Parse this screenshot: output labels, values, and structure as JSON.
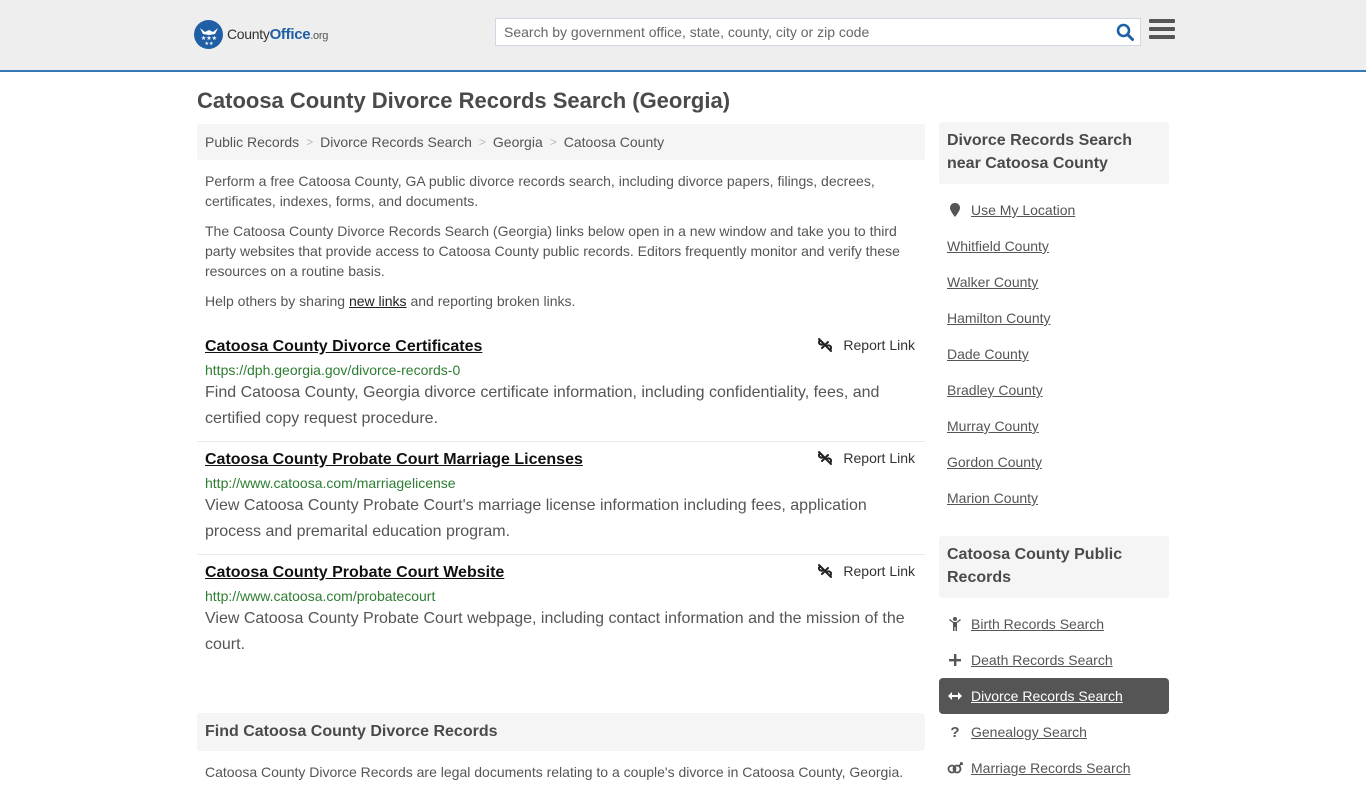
{
  "header": {
    "logo": {
      "name_part1": "County",
      "name_part2": "Office",
      "suffix": ".org"
    },
    "search": {
      "placeholder": "Search by government office, state, county, city or zip code",
      "value": ""
    },
    "accent_color": "#337ab7"
  },
  "page_title": "Catoosa County Divorce Records Search (Georgia)",
  "breadcrumb": [
    {
      "label": "Public Records"
    },
    {
      "label": "Divorce Records Search"
    },
    {
      "label": "Georgia"
    },
    {
      "label": "Catoosa County"
    }
  ],
  "intro": {
    "p1": "Perform a free Catoosa County, GA public divorce records search, including divorce papers, filings, decrees, certificates, indexes, forms, and documents.",
    "p2": "The Catoosa County Divorce Records Search (Georgia) links below open in a new window and take you to third party websites that provide access to Catoosa County public records. Editors frequently monitor and verify these resources on a routine basis.",
    "p3_before": "Help others by sharing ",
    "p3_link": "new links",
    "p3_after": " and reporting broken links."
  },
  "results": [
    {
      "title": "Catoosa County Divorce Certificates",
      "url": "https://dph.georgia.gov/divorce-records-0",
      "description": "Find Catoosa County, Georgia divorce certificate information, including confidentiality, fees, and certified copy request procedure.",
      "report_label": "Report Link"
    },
    {
      "title": "Catoosa County Probate Court Marriage Licenses",
      "url": "http://www.catoosa.com/marriagelicense",
      "description": "View Catoosa County Probate Court's marriage license information including fees, application process and premarital education program.",
      "report_label": "Report Link"
    },
    {
      "title": "Catoosa County Probate Court Website",
      "url": "http://www.catoosa.com/probatecourt",
      "description": "View Catoosa County Probate Court webpage, including contact information and the mission of the court.",
      "report_label": "Report Link"
    }
  ],
  "find_section": {
    "heading": "Find Catoosa County Divorce Records",
    "text": "Catoosa County Divorce Records are legal documents relating to a couple's divorce in Catoosa County, Georgia."
  },
  "sidebar": {
    "nearby": {
      "heading": "Divorce Records Search near Catoosa County",
      "use_location": "Use My Location",
      "counties": [
        "Whitfield County",
        "Walker County",
        "Hamilton County",
        "Dade County",
        "Bradley County",
        "Murray County",
        "Gordon County",
        "Marion County"
      ]
    },
    "public_records": {
      "heading": "Catoosa County Public Records",
      "items": [
        {
          "label": "Birth Records Search",
          "icon": "child-icon",
          "active": false
        },
        {
          "label": "Death Records Search",
          "icon": "plus-icon",
          "active": false
        },
        {
          "label": "Divorce Records Search",
          "icon": "arrows-horizontal-icon",
          "active": true
        },
        {
          "label": "Genealogy Search",
          "icon": "question-icon",
          "active": false
        },
        {
          "label": "Marriage Records Search",
          "icon": "marriage-icon",
          "active": false
        }
      ]
    }
  }
}
